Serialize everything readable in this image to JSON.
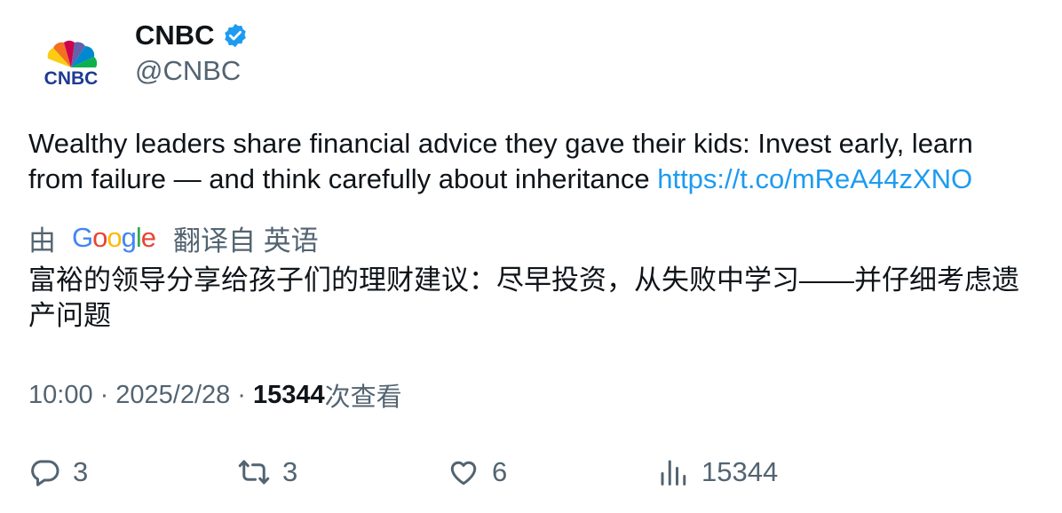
{
  "author": {
    "name": "CNBC",
    "handle": "@CNBC",
    "avatar_text": "CNBC",
    "verified_icon": "verified-badge-icon"
  },
  "tweet": {
    "text": "Wealthy leaders share financial advice they gave their kids: Invest early, learn from failure — and think carefully about inheritance",
    "link": "https://t.co/mReA44zXNO"
  },
  "translation": {
    "prefix": "由",
    "provider": "Google",
    "suffix": "翻译自 英语",
    "text": "富裕的领导分享给孩子们的理财建议：尽早投资，从失败中学习——并仔细考虑遗产问题"
  },
  "meta": {
    "time": "10:00",
    "separator": "·",
    "date": "2025/2/28",
    "views_count": "15344",
    "views_label": "次查看"
  },
  "actions": {
    "replies": "3",
    "retweets": "3",
    "likes": "6",
    "views": "15344"
  },
  "colors": {
    "link": "#1d9bf0",
    "secondary_text": "#536471",
    "primary_text": "#0f1419",
    "verified": "#1d9bf0"
  }
}
